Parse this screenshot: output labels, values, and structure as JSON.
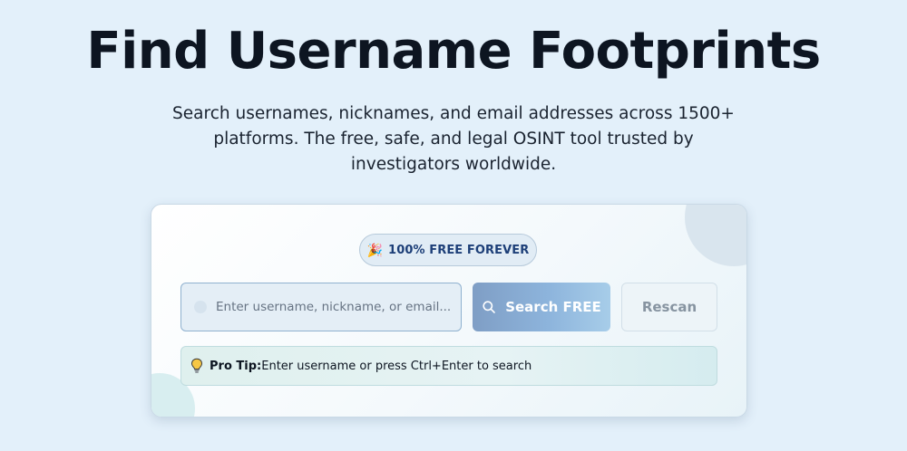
{
  "hero": {
    "title": "Find Username Footprints",
    "subtitle": "Search usernames, nicknames, and email addresses across 1500+ platforms. The free, safe, and legal OSINT tool trusted by investigators worldwide."
  },
  "search_card": {
    "badge": {
      "icon": "party-popper-icon",
      "label": "100% FREE FOREVER"
    },
    "input": {
      "placeholder": "Enter username, nickname, or email...",
      "value": ""
    },
    "search_button": {
      "icon": "search-icon",
      "label": "Search FREE"
    },
    "rescan_button": {
      "label": "Rescan"
    },
    "tip": {
      "icon": "lightbulb-icon",
      "label": "Pro Tip:",
      "text": "Enter username or press Ctrl+Enter to search"
    }
  },
  "colors": {
    "page_background": "#e3f0fa",
    "title_text": "#0d1521",
    "badge_text": "#1d3f78",
    "search_button_start": "#7f9ec5",
    "search_button_end": "#a7cde9",
    "rescan_text": "#8794a1"
  }
}
